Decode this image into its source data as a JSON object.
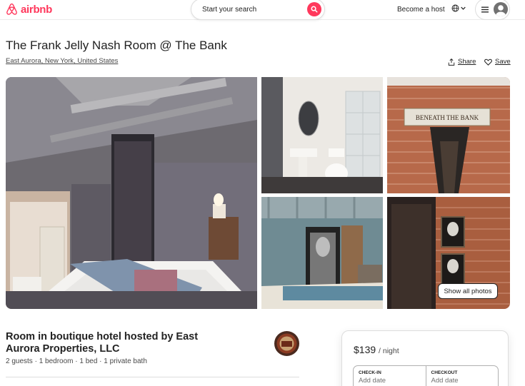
{
  "header": {
    "logo_text": "airbnb",
    "search_placeholder": "Start your search",
    "become_host": "Become a host"
  },
  "listing": {
    "title": "The Frank Jelly Nash Room @ The Bank",
    "location": "East Aurora, New York, United States",
    "share_label": "Share",
    "save_label": "Save",
    "show_all_photos": "Show all photos"
  },
  "host": {
    "title": "Room in boutique hotel hosted by East Aurora Properties, LLC",
    "details": "2 guests · 1 bedroom · 1 bed · 1 private bath"
  },
  "booking": {
    "price": "$139",
    "unit": "/ night",
    "checkin_label": "CHECK-IN",
    "checkin_value": "Add date",
    "checkout_label": "CHECKOUT",
    "checkout_value": "Add date"
  },
  "colors": {
    "brand": "#ff385c",
    "text": "#222222",
    "muted": "#717171"
  },
  "icons": [
    "airbnb-logo-icon",
    "search-icon",
    "globe-icon",
    "chevron-down-icon",
    "hamburger-menu-icon",
    "user-avatar-icon",
    "share-icon",
    "heart-icon"
  ]
}
